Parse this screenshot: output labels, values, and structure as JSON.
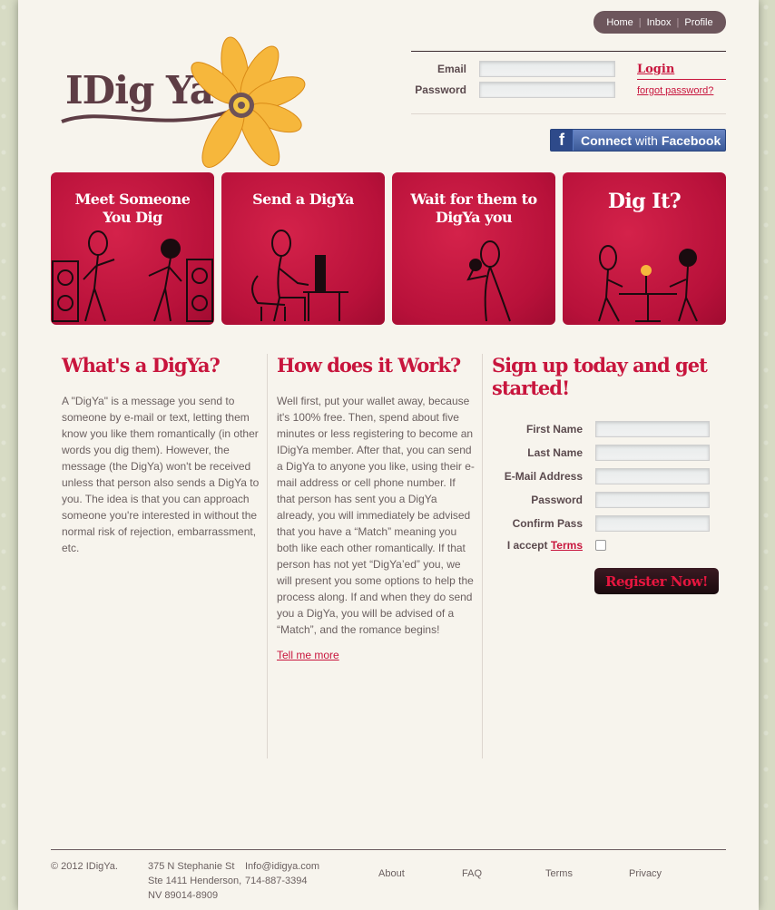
{
  "nav": {
    "home": "Home",
    "inbox": "Inbox",
    "profile": "Profile",
    "sep": "|"
  },
  "logo": {
    "text": "IDig Ya"
  },
  "login": {
    "email_label": "Email",
    "password_label": "Password",
    "login_label": "Login",
    "forgot_label": "forgot password?"
  },
  "facebook": {
    "connect": "Connect",
    "with": "with",
    "brand": "Facebook",
    "icon": "f"
  },
  "tiles": [
    {
      "title_line1": "Meet Someone",
      "title_line2": "You Dig"
    },
    {
      "title_line1": "Send a DigYa",
      "title_line2": ""
    },
    {
      "title_line1": "Wait for them to",
      "title_line2": "DigYa you"
    },
    {
      "title_line1": "Dig It?",
      "title_line2": ""
    }
  ],
  "whats": {
    "heading": "What's a DigYa?",
    "body": "A \"DigYa\" is a message you send to someone by e-mail or text, letting them know you like them romantically (in other words you dig them). However, the message (the DigYa) won't be received unless that person also sends a DigYa to you. The idea is that you can approach someone you're interested in without the normal risk of rejection, embarrassment, etc."
  },
  "how": {
    "heading": "How does it Work?",
    "body": "Well first, put your wallet away, because it's 100% free. Then, spend about five minutes or less registering to become an IDigYa member. After that, you can send a DigYa to anyone you like, using their e-mail address or cell phone number. If that person has sent you a DigYa already, you will immediately be advised that you have a “Match” meaning you both like each other romantically. If that person has not yet “DigYa’ed” you, we will present you some options to help the process along. If and when they do send you a DigYa, you will be advised of a “Match”, and the romance begins!",
    "tell_more": "Tell me more"
  },
  "signup": {
    "heading": "Sign up today and get started!",
    "first_name": "First Name",
    "last_name": "Last Name",
    "email": "E-Mail Address",
    "password": "Password",
    "confirm": "Confirm Pass",
    "accept": "I accept",
    "terms": "Terms",
    "register": "Register Now!"
  },
  "footer": {
    "copyright": "© 2012 IDigYa.",
    "addr1": "375 N Stephanie St",
    "addr2": "Ste 1411 Henderson,",
    "addr3": "NV 89014-8909",
    "email": "Info@idigya.com",
    "phone": "714-887-3394",
    "about": "About",
    "faq": "FAQ",
    "terms": "Terms",
    "privacy": "Privacy"
  }
}
